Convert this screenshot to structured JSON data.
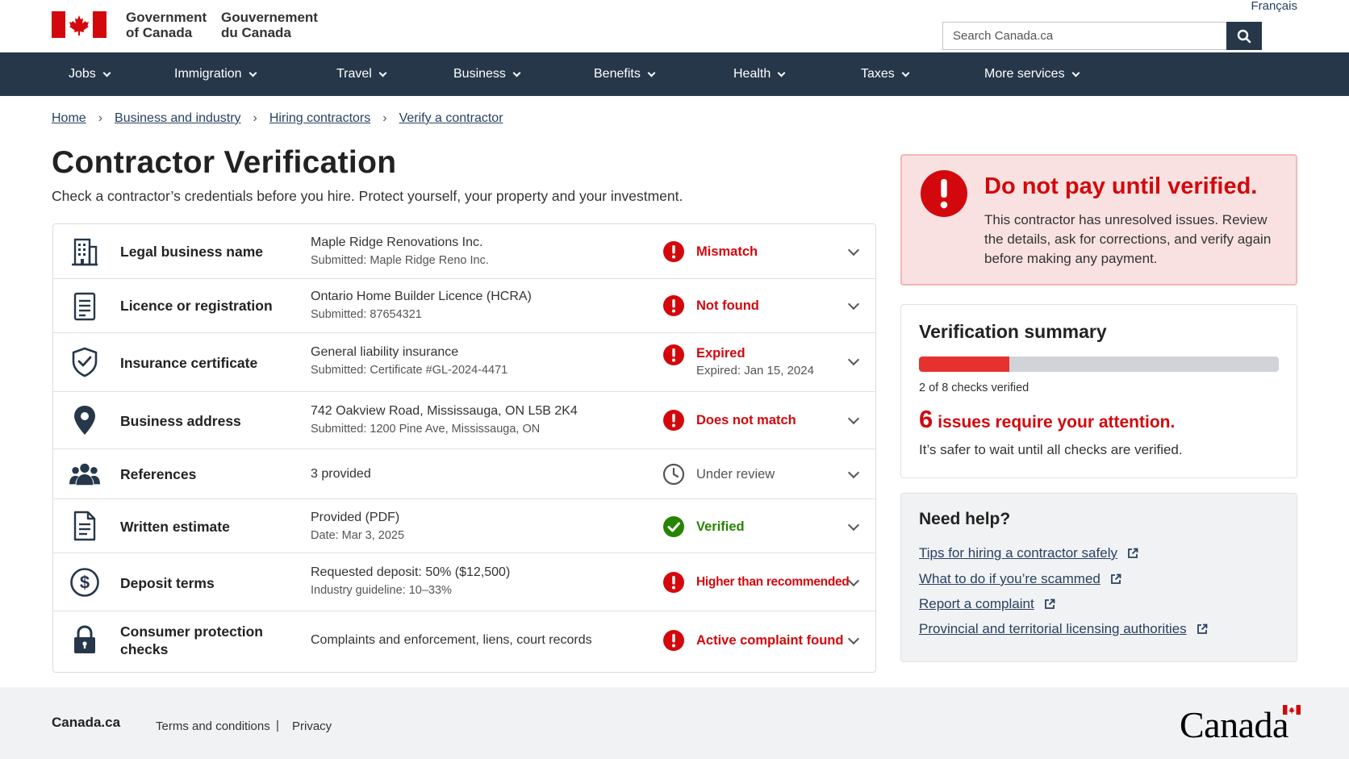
{
  "header": {
    "govt_en_line1": "Government",
    "govt_en_line2": "of Canada",
    "govt_fr_line1": "Gouvernement",
    "govt_fr_line2": "du Canada",
    "language_link": "Français",
    "search_placeholder": "Search Canada.ca",
    "search_icon": "search-icon",
    "flag_icon": "canada-flag-icon"
  },
  "nav": {
    "items": [
      {
        "label": "Jobs"
      },
      {
        "label": "Immigration"
      },
      {
        "label": "Travel"
      },
      {
        "label": "Business"
      },
      {
        "label": "Benefits"
      },
      {
        "label": "Health"
      },
      {
        "label": "Taxes"
      },
      {
        "label": "More services"
      }
    ]
  },
  "breadcrumb": [
    "Home",
    "Business and industry",
    "Hiring contractors",
    "Verify a contractor"
  ],
  "page": {
    "title": "Contractor Verification",
    "intro": "Check a contractor’s credentials before you hire. Protect yourself, your property and your investment."
  },
  "checks": [
    {
      "icon": "building-icon",
      "label": "Legal business name",
      "value": "Maple Ridge Renovations Inc.",
      "sub": "Submitted: Maple Ridge Reno Inc.",
      "status": "Mismatch",
      "status_sub": "",
      "status_type": "error"
    },
    {
      "icon": "document-icon",
      "label": "Licence or registration",
      "value": "Ontario Home Builder Licence (HCRA)",
      "sub": "Submitted: 87654321",
      "status": "Not found",
      "status_sub": "",
      "status_type": "error"
    },
    {
      "icon": "shield-check-icon",
      "label": "Insurance certificate",
      "value": "General liability insurance",
      "sub": "Submitted: Certificate #GL-2024-4471",
      "status": "Expired",
      "status_sub": "Expired: Jan 15, 2024",
      "status_type": "error"
    },
    {
      "icon": "location-pin-icon",
      "label": "Business address",
      "value": "742 Oakview Road, Mississauga, ON L5B 2K4",
      "sub": "Submitted: 1200 Pine Ave, Mississauga, ON",
      "status": "Does not match",
      "status_sub": "",
      "status_type": "error"
    },
    {
      "icon": "people-icon",
      "label": "References",
      "value": "3 provided",
      "sub": "",
      "status": "Under review",
      "status_sub": "",
      "status_type": "pending"
    },
    {
      "icon": "file-text-icon",
      "label": "Written estimate",
      "value": "Provided (PDF)",
      "sub": "Date: Mar 3, 2025",
      "status": "Verified",
      "status_sub": "",
      "status_type": "success"
    },
    {
      "icon": "dollar-circle-icon",
      "label": "Deposit terms",
      "value": "Requested deposit: 50% ($12,500)",
      "sub": "Industry guideline: 10–33%",
      "status": "Higher than recommended",
      "status_sub": "",
      "status_type": "error"
    },
    {
      "icon": "lock-icon",
      "label": "Consumer protection checks",
      "value": "Complaints and enforcement, liens, court records",
      "sub": "",
      "status": "Active complaint found",
      "status_sub": "",
      "status_type": "error"
    }
  ],
  "alert": {
    "title": "Do not pay until verified.",
    "body": "This contractor has unresolved issues. Review the details, ask for corrections, and verify again before making any payment."
  },
  "summary": {
    "title": "Verification summary",
    "verified": 2,
    "total": 8,
    "progress_label": "2 of 8 checks verified",
    "issues_count": "6",
    "issues_text": "issues require your attention.",
    "safer_text": "It’s safer to wait until all checks are verified."
  },
  "help": {
    "title": "Need help?",
    "links": [
      "Tips for hiring a contractor safely",
      "What to do if you’re scammed",
      "Report a complaint",
      "Provincial and territorial licensing authorities"
    ]
  },
  "footer": {
    "brand": "Canada.ca",
    "terms": "Terms and conditions",
    "separator": "|",
    "privacy": "Privacy",
    "wordmark": "Canada"
  },
  "colors": {
    "nav_bg": "#26374a",
    "error": "#d3080c",
    "success": "#278400",
    "link": "#284162",
    "alert_bg": "#f9e1e1"
  }
}
